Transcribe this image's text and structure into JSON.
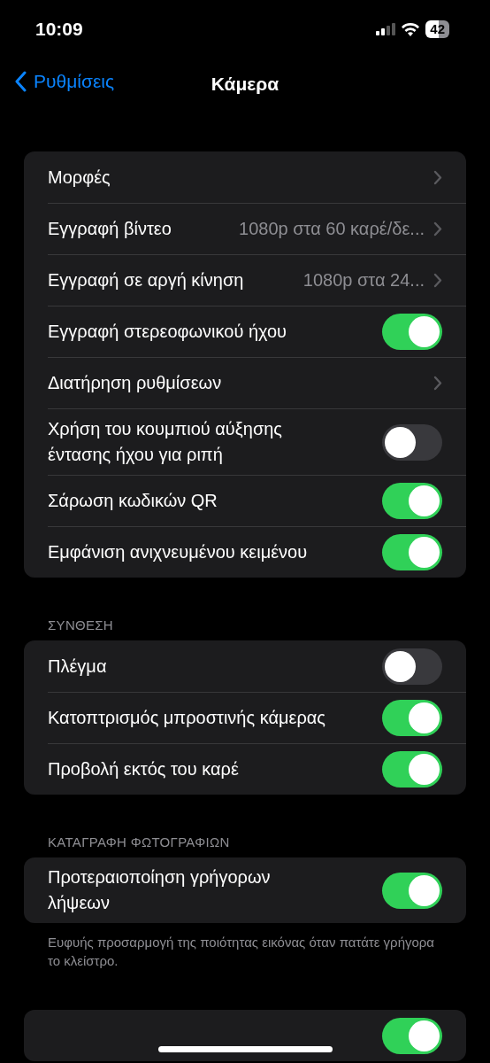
{
  "status_bar": {
    "time": "10:09",
    "battery": "42"
  },
  "nav": {
    "back": "Ρυθμίσεις",
    "title": "Κάμερα"
  },
  "groups": [
    {
      "rows": [
        {
          "kind": "link",
          "label": "Μορφές"
        },
        {
          "kind": "link",
          "label": "Εγγραφή βίντεο",
          "value": "1080p στα 60 καρέ/δε..."
        },
        {
          "kind": "link",
          "label": "Εγγραφή σε αργή κίνηση",
          "value": "1080p στα 24..."
        },
        {
          "kind": "toggle",
          "label": "Εγγραφή στερεοφωνικού ήχου",
          "on": true
        },
        {
          "kind": "link",
          "label": "Διατήρηση ρυθμίσεων"
        },
        {
          "kind": "toggle",
          "label": "Χρήση του κουμπιού αύξησης έντασης ήχου για ριπή",
          "on": false
        },
        {
          "kind": "toggle",
          "label": "Σάρωση κωδικών QR",
          "on": true
        },
        {
          "kind": "toggle",
          "label": "Εμφάνιση ανιχνευμένου κειμένου",
          "on": true
        }
      ]
    },
    {
      "header": "ΣΥΝΘΕΣΗ",
      "rows": [
        {
          "kind": "toggle",
          "label": "Πλέγμα",
          "on": false
        },
        {
          "kind": "toggle",
          "label": "Κατοπτρισμός μπροστινής κάμερας",
          "on": true
        },
        {
          "kind": "toggle",
          "label": "Προβολή εκτός του καρέ",
          "on": true
        }
      ]
    },
    {
      "header": "ΚΑΤΑΓΡΑΦΗ ΦΩΤΟΓΡΑΦΙΩΝ",
      "rows": [
        {
          "kind": "toggle",
          "label": "Προτεραιοποίηση γρήγορων λήψεων",
          "on": true
        }
      ],
      "footer": "Ευφυής προσαρμογή της ποιότητας εικόνας όταν πατάτε γρήγορα το κλείστρο."
    },
    {
      "rows": [
        {
          "kind": "toggle",
          "on": true
        }
      ]
    }
  ]
}
